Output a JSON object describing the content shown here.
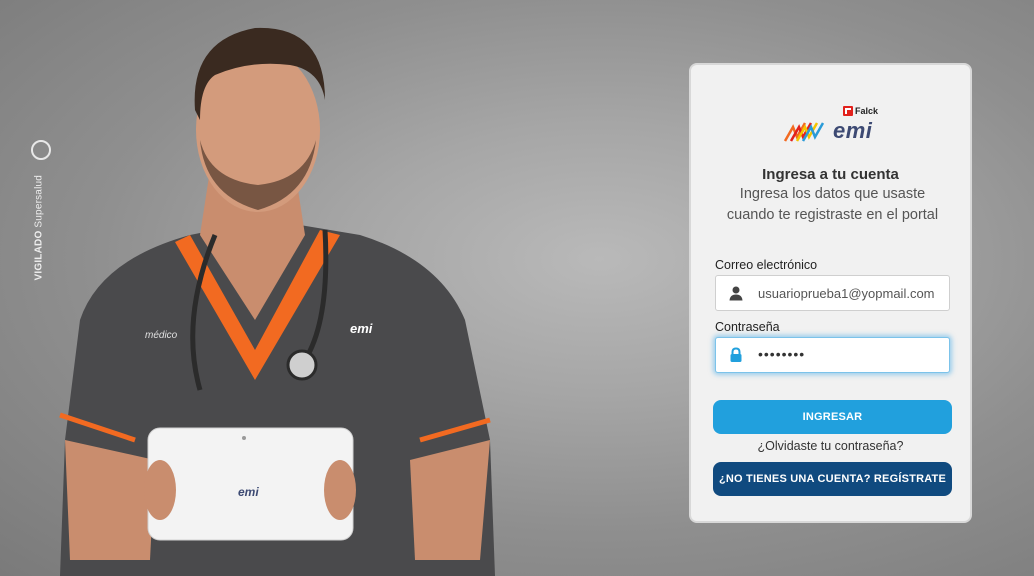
{
  "vigilado": {
    "bold": "VIGILADO",
    "text": "Supersalud"
  },
  "doctor": {
    "chest_badge": "médico",
    "logo": "emi",
    "tablet_logo": "emi"
  },
  "login": {
    "brand_parent": "Falck",
    "brand": "emi",
    "title": "Ingresa a tu cuenta",
    "subtitle": "Ingresa los datos que usaste cuando te registraste en el portal",
    "email_label": "Correo electrónico",
    "email_value": "usuarioprueba1@yopmail.com",
    "password_label": "Contraseña",
    "password_value": "••••••••",
    "login_button": "INGRESAR",
    "forgot_link": "¿Olvidaste tu contraseña?",
    "register_button": "¿NO TIENES UNA CUENTA? REGÍSTRATE"
  },
  "icons": {
    "email": "user-icon",
    "password": "lock-icon"
  },
  "colors": {
    "primary": "#21a0dd",
    "secondary": "#104a7f",
    "brand_red": "#e2211c",
    "scrub_orange": "#f26a21"
  }
}
